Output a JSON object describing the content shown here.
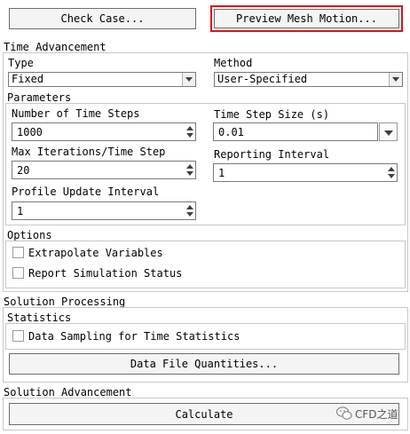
{
  "buttons": {
    "check_case": "Check Case...",
    "preview_mesh_motion": "Preview Mesh Motion...",
    "data_file_quantities": "Data File Quantities...",
    "calculate": "Calculate"
  },
  "time_advancement": {
    "title": "Time Advancement",
    "type_label": "Type",
    "type_value": "Fixed",
    "method_label": "Method",
    "method_value": "User-Specified"
  },
  "parameters": {
    "title": "Parameters",
    "num_time_steps_label": "Number of Time Steps",
    "num_time_steps_value": "1000",
    "time_step_size_label": "Time Step Size (s)",
    "time_step_size_value": "0.01",
    "max_iter_label": "Max Iterations/Time Step",
    "max_iter_value": "20",
    "reporting_interval_label": "Reporting Interval",
    "reporting_interval_value": "1",
    "profile_update_label": "Profile Update Interval",
    "profile_update_value": "1"
  },
  "options": {
    "title": "Options",
    "extrapolate_label": "Extrapolate Variables",
    "report_status_label": "Report Simulation Status"
  },
  "solution_processing": {
    "title": "Solution Processing",
    "statistics_title": "Statistics",
    "data_sampling_label": "Data Sampling for Time Statistics"
  },
  "solution_advancement": {
    "title": "Solution Advancement"
  },
  "watermark": {
    "text": "CFD之道"
  },
  "colors": {
    "highlight": "#d9141b",
    "button_bg": "#f4f4f4"
  }
}
